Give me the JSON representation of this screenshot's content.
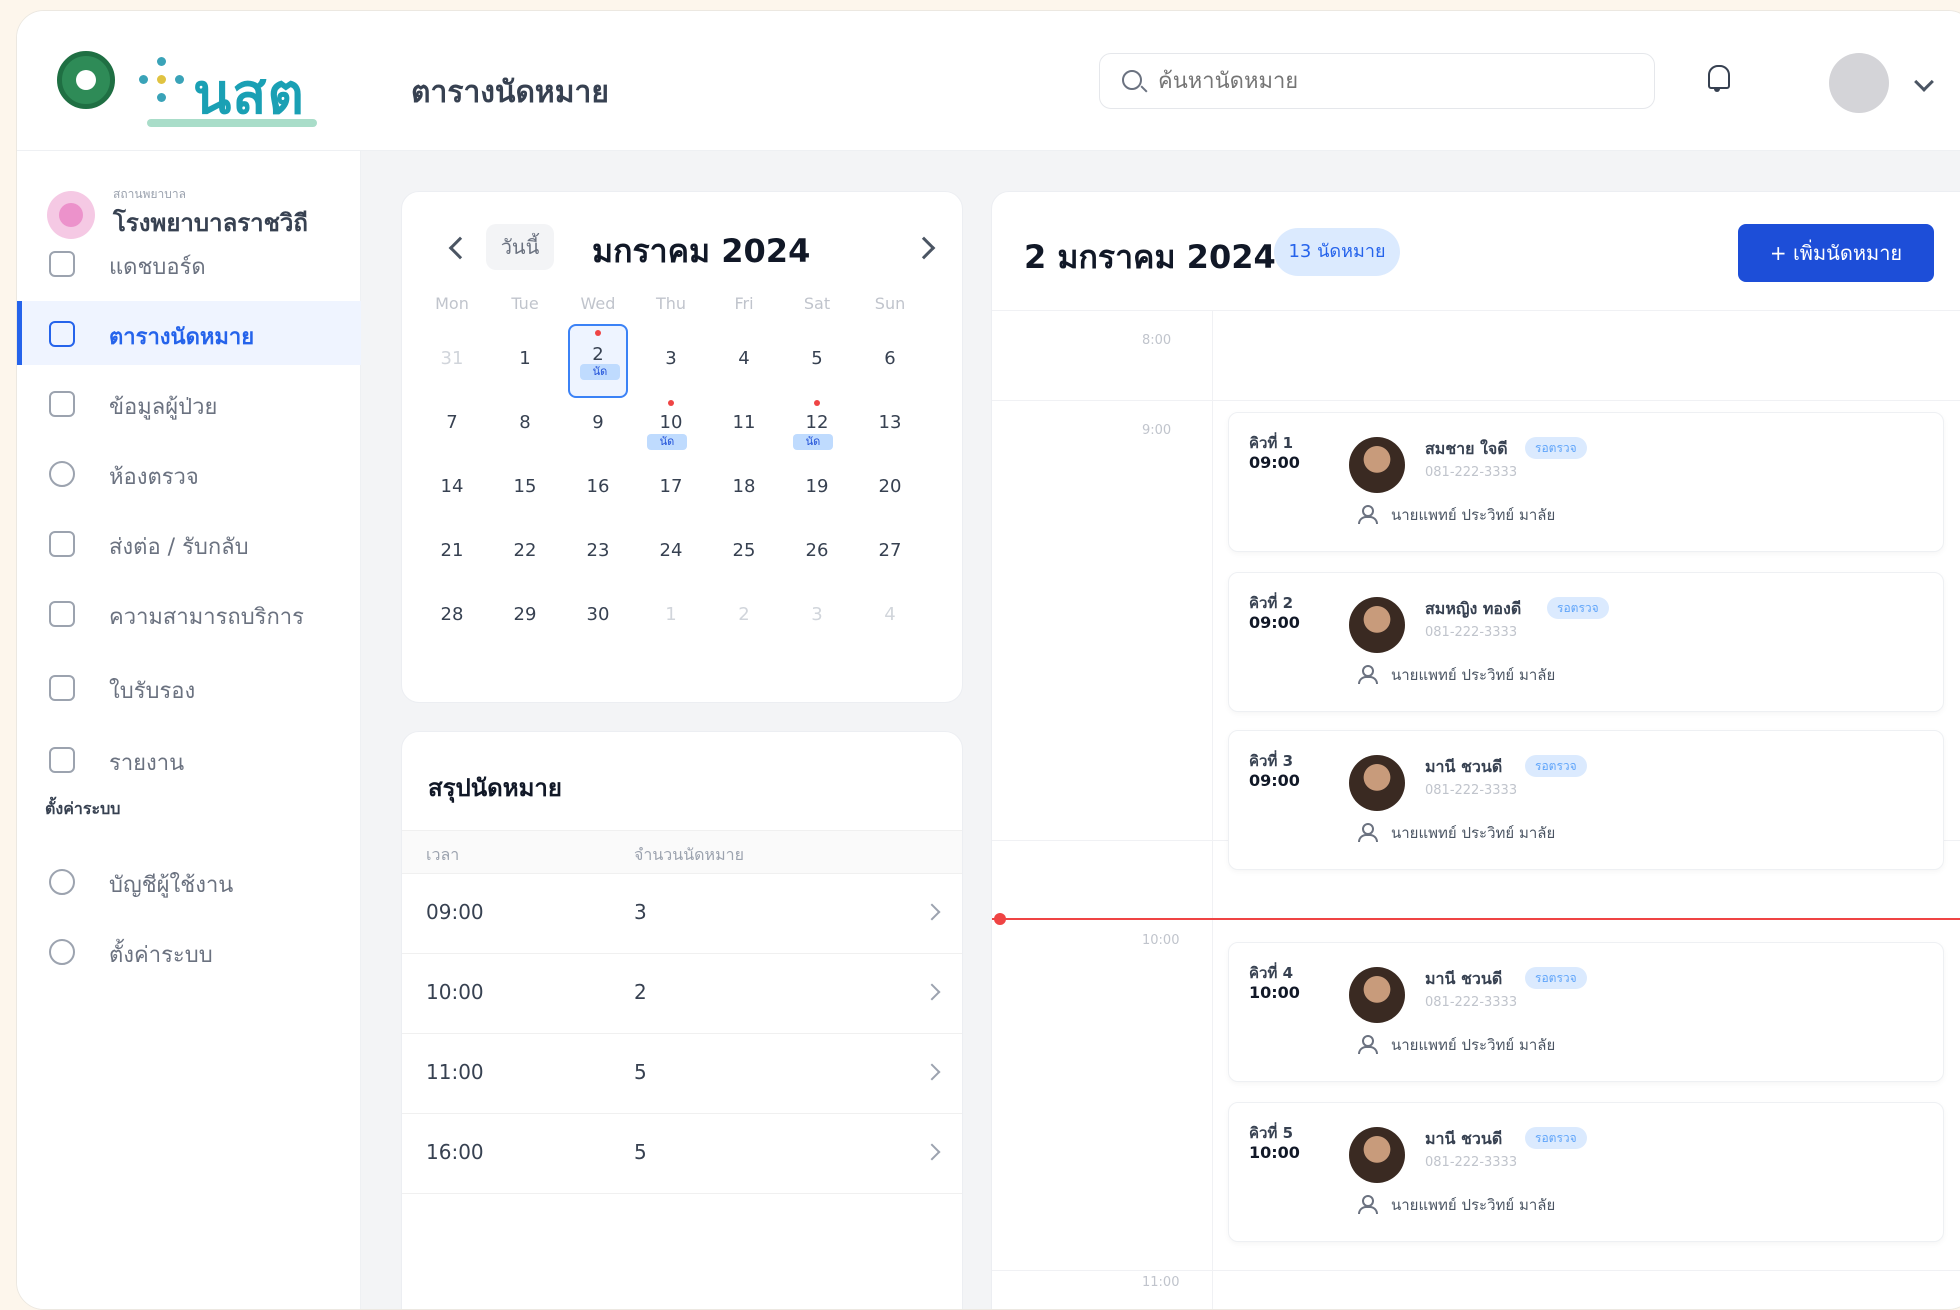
{
  "header": {
    "logo_text": "นสต",
    "page_title": "ตารางนัดหมาย",
    "search_placeholder": "ค้นหานัดหมาย"
  },
  "sidebar": {
    "org_sub": "สถานพยาบาล",
    "org_name": "โรงพยาบาลราชวิถี",
    "items": [
      {
        "label": "แดชบอร์ด",
        "icon": "home-icon",
        "active": false
      },
      {
        "label": "ตารางนัดหมาย",
        "icon": "calendar-icon",
        "active": true
      },
      {
        "label": "ข้อมูลผู้ป่วย",
        "icon": "clipboard-icon",
        "active": false
      },
      {
        "label": "ห้องตรวจ",
        "icon": "heart-icon",
        "active": false
      },
      {
        "label": "ส่งต่อ / รับกลับ",
        "icon": "transfer-icon",
        "active": false
      },
      {
        "label": "ความสามารถบริการ",
        "icon": "chart-icon",
        "active": false
      },
      {
        "label": "ใบรับรอง",
        "icon": "certificate-icon",
        "active": false
      },
      {
        "label": "รายงาน",
        "icon": "report-icon",
        "active": false
      }
    ],
    "section_title": "ตั้งค่าระบบ",
    "settings_items": [
      {
        "label": "บัญชีผู้ใช้งาน",
        "icon": "users-icon"
      },
      {
        "label": "ตั้งค่าระบบ",
        "icon": "settings-icon"
      }
    ]
  },
  "calendar": {
    "today_label": "วันนี้",
    "month_label": "มกราคม 2024",
    "dow": [
      "Mon",
      "Tue",
      "Wed",
      "Thu",
      "Fri",
      "Sat",
      "Sun"
    ],
    "weeks": [
      [
        "31",
        "1",
        "2",
        "3",
        "4",
        "5",
        "6"
      ],
      [
        "7",
        "8",
        "9",
        "10",
        "11",
        "12",
        "13"
      ],
      [
        "14",
        "15",
        "16",
        "17",
        "18",
        "19",
        "20"
      ],
      [
        "21",
        "22",
        "23",
        "24",
        "25",
        "26",
        "27"
      ],
      [
        "28",
        "29",
        "30",
        "1",
        "2",
        "3",
        "4"
      ]
    ],
    "selected_pill": "นัด",
    "pill_10": "นัด",
    "pill_12": "นัด"
  },
  "summary": {
    "title": "สรุปนัดหมาย",
    "col_time": "เวลา",
    "col_count": "จำนวนนัดหมาย",
    "rows": [
      {
        "time": "09:00",
        "count": "3"
      },
      {
        "time": "10:00",
        "count": "2"
      },
      {
        "time": "11:00",
        "count": "5"
      },
      {
        "time": "16:00",
        "count": "5"
      }
    ]
  },
  "day": {
    "title": "2 มกราคม 2024",
    "count_pill": "13 นัดหมาย",
    "add_button": "+ เพิ่มนัดหมาย",
    "slot_labels": [
      "8:00",
      "9:00",
      "10:00",
      "11:00"
    ],
    "appointments": [
      {
        "queue": "คิวที่ 1",
        "time": "09:00",
        "name": "สมชาย ใจดี",
        "tag": "รอตรวจ",
        "phone": "081-222-3333",
        "doctor": "นายแพทย์ ประวิทย์ มาลัย"
      },
      {
        "queue": "คิวที่ 2",
        "time": "09:00",
        "name": "สมหญิง ทองดี",
        "tag": "รอตรวจ",
        "phone": "081-222-3333",
        "doctor": "นายแพทย์ ประวิทย์ มาลัย"
      },
      {
        "queue": "คิวที่ 3",
        "time": "09:00",
        "name": "มานี ชวนดี",
        "tag": "รอตรวจ",
        "phone": "081-222-3333",
        "doctor": "นายแพทย์ ประวิทย์ มาลัย"
      },
      {
        "queue": "คิวที่ 4",
        "time": "10:00",
        "name": "มานี ชวนดี",
        "tag": "รอตรวจ",
        "phone": "081-222-3333",
        "doctor": "นายแพทย์ ประวิทย์ มาลัย"
      },
      {
        "queue": "คิวที่ 5",
        "time": "10:00",
        "name": "มานี ชวนดี",
        "tag": "รอตรวจ",
        "phone": "081-222-3333",
        "doctor": "นายแพทย์ ประวิทย์ มาลัย"
      }
    ]
  },
  "colors": {
    "accent": "#2563eb",
    "now_line": "#ef4444",
    "logo": "#1aa0b4",
    "background": "#fdf6ec"
  }
}
